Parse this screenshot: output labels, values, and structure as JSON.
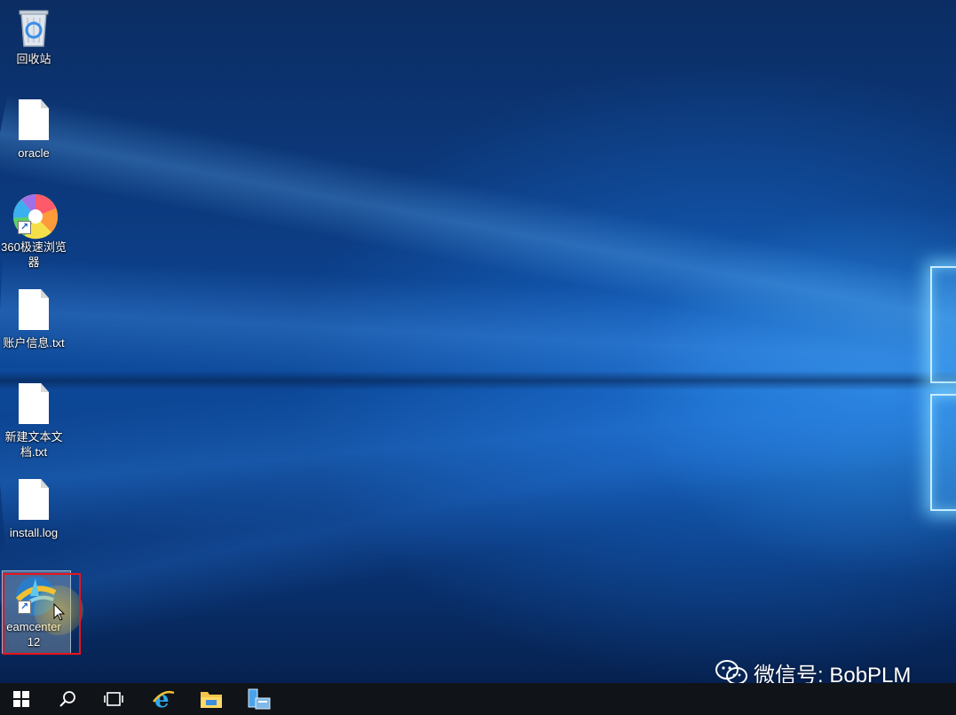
{
  "desktop": {
    "icons": [
      {
        "name": "recycle-bin",
        "label": "回收站"
      },
      {
        "name": "oracle-file",
        "label": "oracle"
      },
      {
        "name": "browser-360",
        "label": "360极速浏览\n器"
      },
      {
        "name": "account-info-file",
        "label": "账户信息.txt"
      },
      {
        "name": "new-text-doc",
        "label": "新建文本文\n档.txt"
      },
      {
        "name": "install-log",
        "label": "install.log"
      },
      {
        "name": "teamcenter",
        "label": "eamcenter\n12"
      }
    ],
    "selected_icon": "teamcenter"
  },
  "watermark": {
    "icon": "wechat-icon",
    "text": "微信号: BobPLM"
  },
  "taskbar": {
    "buttons": [
      "start-icon",
      "search-icon",
      "task-view-icon",
      "ie-icon",
      "file-explorer-icon",
      "server-manager-icon"
    ]
  },
  "colors": {
    "highlight": "#e8141c",
    "taskbar": "#101318",
    "windows_accent": "#1a7ae0"
  }
}
